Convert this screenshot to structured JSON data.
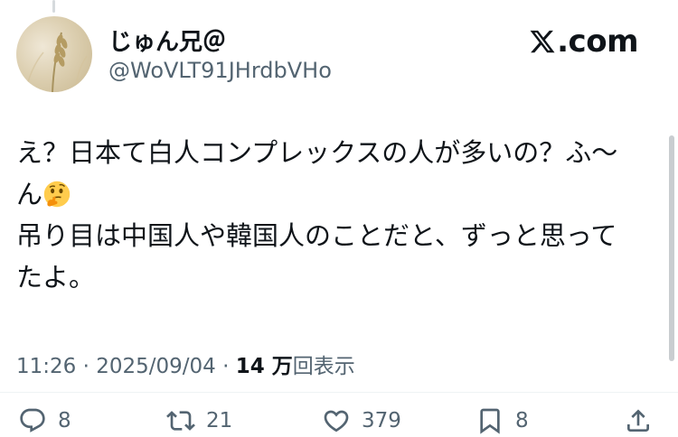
{
  "user": {
    "display_name": "じゅん兄＠",
    "handle": "@WoVLT91JHrdbVHo"
  },
  "brand": {
    "logo_text": ".com"
  },
  "tweet": {
    "lines": [
      "え？日本て白人コンプレックスの人が多いの？ふ〜",
      "ん",
      "吊り目は中国人や韓国人のことだと、ずっと思って",
      "たよ。"
    ],
    "emoji": "thinking-face"
  },
  "meta": {
    "time": "11:26",
    "date": "2025/09/04",
    "views_count": "14 万",
    "views_label": "回表示",
    "separator": "·"
  },
  "actions": {
    "replies": "8",
    "reposts": "21",
    "likes": "379",
    "bookmarks": "8"
  },
  "colors": {
    "text": "#0f1419",
    "secondary": "#536471",
    "divider": "#eff3f4"
  }
}
